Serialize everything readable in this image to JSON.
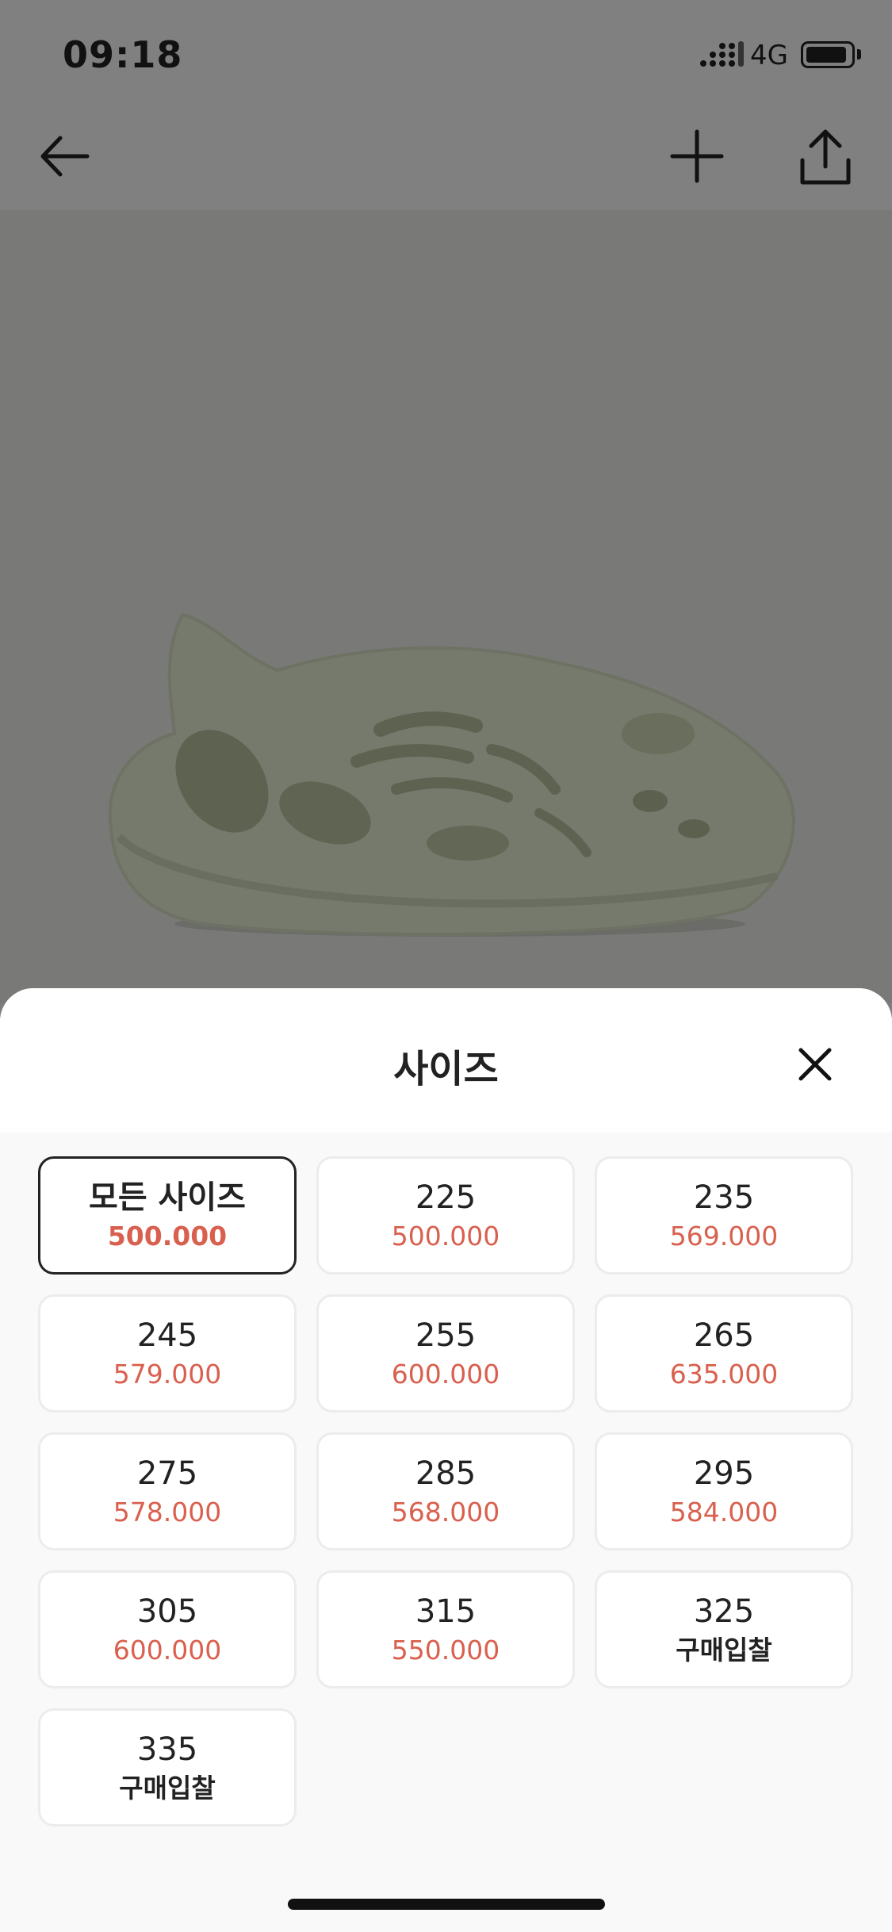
{
  "status_bar": {
    "time": "09:18",
    "network": "4G"
  },
  "nav": {
    "back_icon": "arrow-left-icon",
    "add_icon": "plus-icon",
    "share_icon": "share-icon"
  },
  "product": {
    "image_icon": "foam-runner-shoe-image"
  },
  "sheet": {
    "title": "사이즈",
    "close_icon": "close-icon",
    "sizes": [
      {
        "size": "모든 사이즈",
        "price": "500.000",
        "selected": true
      },
      {
        "size": "225",
        "price": "500.000"
      },
      {
        "size": "235",
        "price": "569.000"
      },
      {
        "size": "245",
        "price": "579.000"
      },
      {
        "size": "255",
        "price": "600.000"
      },
      {
        "size": "265",
        "price": "635.000"
      },
      {
        "size": "275",
        "price": "578.000"
      },
      {
        "size": "285",
        "price": "568.000"
      },
      {
        "size": "295",
        "price": "584.000"
      },
      {
        "size": "305",
        "price": "600.000"
      },
      {
        "size": "315",
        "price": "550.000"
      },
      {
        "size": "325",
        "price": "구매입찰",
        "bid": true
      },
      {
        "size": "335",
        "price": "구매입찰",
        "bid": true
      }
    ]
  },
  "colors": {
    "accent_price": "#d9604e",
    "overlay": "#808080",
    "selected_border": "#222222"
  }
}
